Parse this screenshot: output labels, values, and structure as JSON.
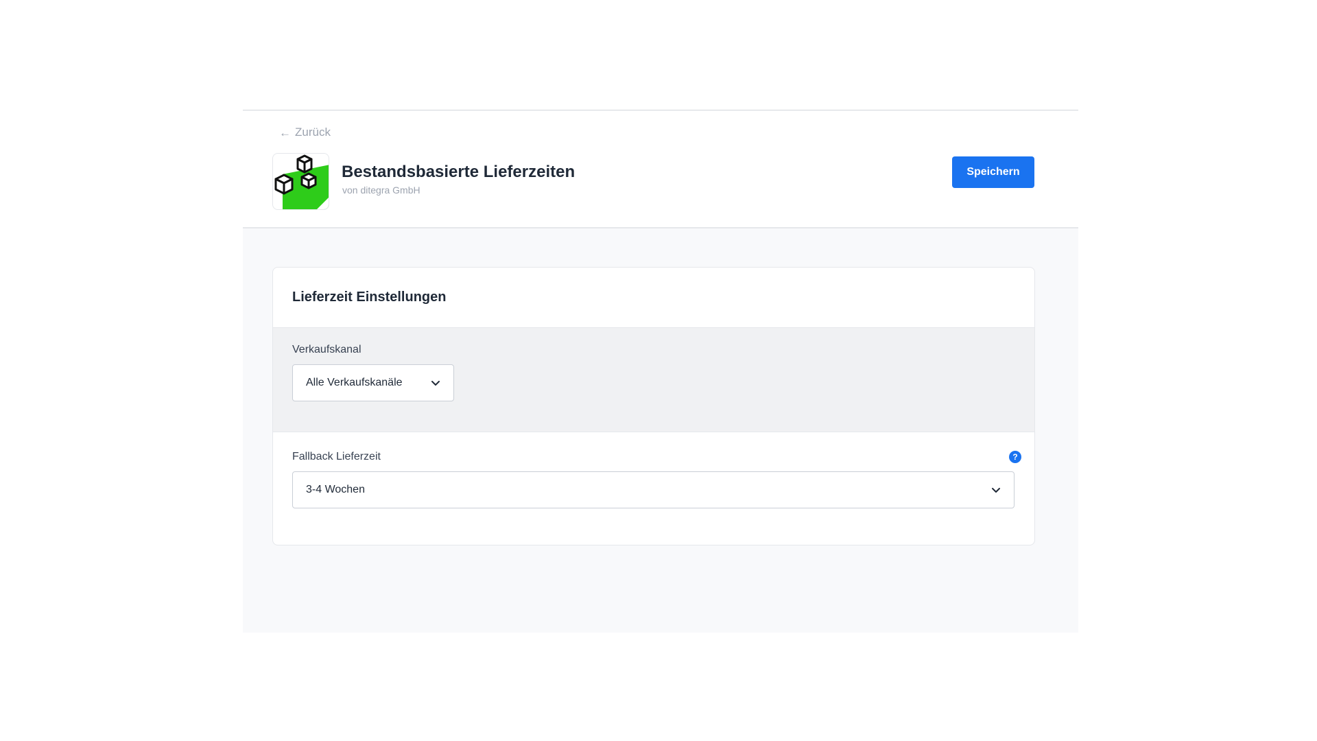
{
  "header": {
    "back_label": "Zurück",
    "app_title": "Bestandsbasierte Lieferzeiten",
    "app_vendor": "von ditegra GmbH",
    "save_label": "Speichern"
  },
  "card": {
    "title": "Lieferzeit Einstellungen",
    "sales_channel": {
      "label": "Verkaufskanal",
      "selected": "Alle Verkaufskanäle"
    },
    "fallback": {
      "label": "Fallback Lieferzeit",
      "selected": "3-4 Wochen",
      "help_glyph": "?"
    }
  },
  "colors": {
    "primary": "#1a73f0",
    "icon_green": "#2ecc1a",
    "content_bg": "#f8f9fb",
    "section_gray": "#f0f1f3"
  }
}
